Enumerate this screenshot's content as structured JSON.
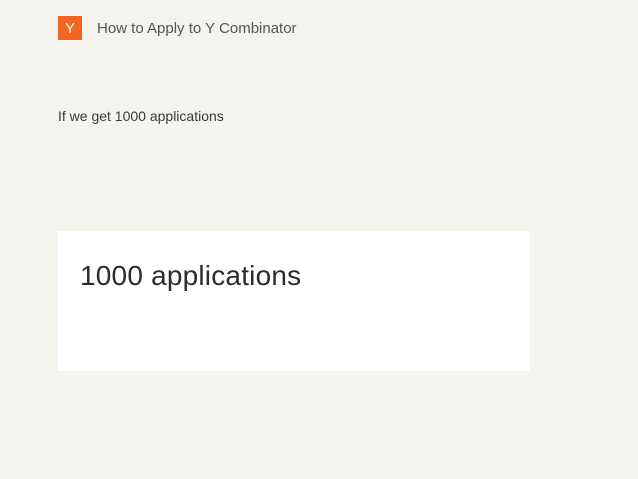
{
  "header": {
    "logo_letter": "Y",
    "title": "How to Apply to Y Combinator"
  },
  "slide": {
    "subtitle": "If we get 1000 applications",
    "panel_text": "1000 applications"
  },
  "colors": {
    "background": "#f5f3ee",
    "logo_bg": "#f26522",
    "panel_bg": "#ffffff"
  }
}
